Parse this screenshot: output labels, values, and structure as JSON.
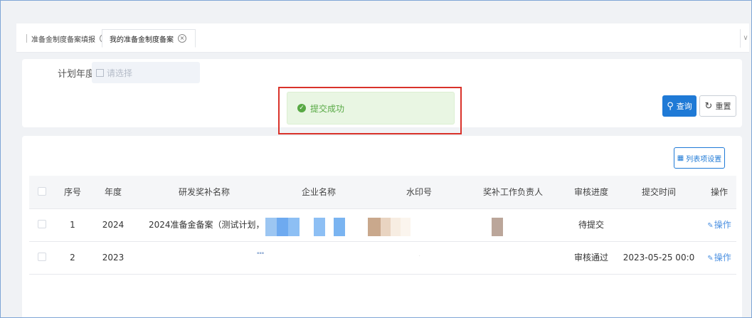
{
  "tabs": [
    {
      "label": "准备金制度备案填报",
      "close": "×"
    },
    {
      "label": "我的准备金制度备案",
      "close": "×"
    }
  ],
  "tab_dropdown": "∨",
  "search": {
    "year_label": "计划年度",
    "year_placeholder": "请选择",
    "query_label": "查询",
    "query_icon": "search-icon",
    "reset_label": "重置",
    "reset_icon": "refresh-icon"
  },
  "toast": {
    "message": "提交成功",
    "icon": "check-circle-icon",
    "color": "#58a944"
  },
  "table": {
    "settings_label": "列表项设置",
    "columns": [
      "序号",
      "年度",
      "研发奖补名称",
      "企业名称",
      "水印号",
      "奖补工作负责人",
      "审核进度",
      "提交时间",
      "操作"
    ],
    "rows": [
      {
        "seq": "1",
        "year": "2024",
        "name": "2024准备金备案（测试计划，1",
        "status": "待提交",
        "time": "",
        "op": "操作"
      },
      {
        "seq": "2",
        "year": "2023",
        "name": "",
        "status": "审核通过",
        "time": "2023-05-25 00:0",
        "op": "操作"
      }
    ]
  },
  "colors": {
    "accent": "#1f7ad6",
    "highlight_border": "#d9322a",
    "link": "#4a8fe0"
  }
}
